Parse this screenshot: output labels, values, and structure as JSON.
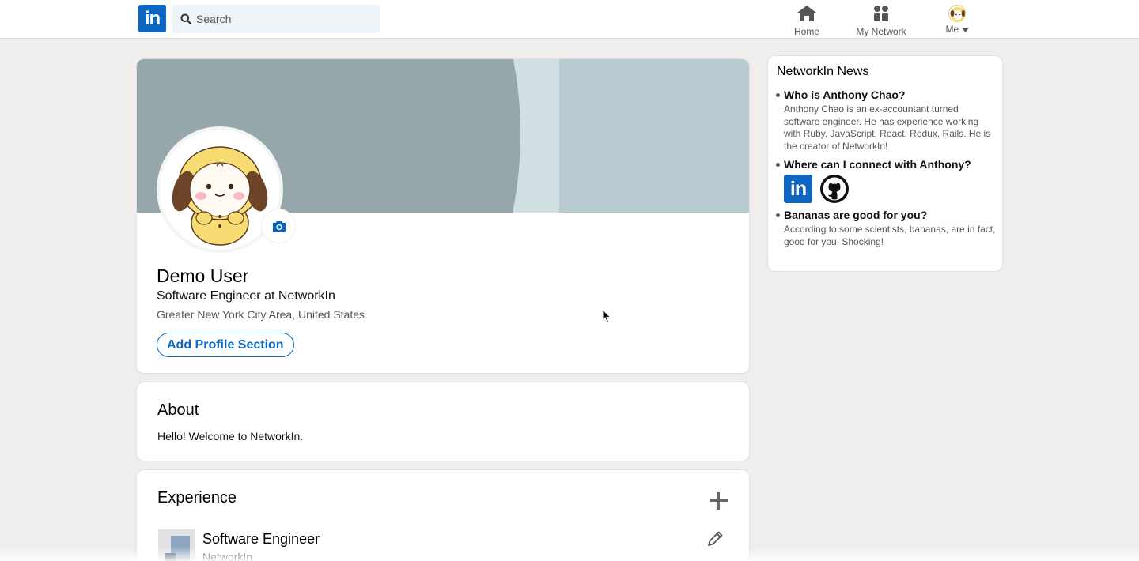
{
  "nav": {
    "logo_text": "in",
    "search_placeholder": "Search",
    "home_label": "Home",
    "network_label": "My Network",
    "me_label": "Me"
  },
  "profile": {
    "name": "Demo User",
    "headline": "Software Engineer at NetworkIn",
    "location": "Greater New York City Area, United States",
    "add_section_label": "Add Profile Section"
  },
  "about": {
    "title": "About",
    "text": "Hello! Welcome to NetworkIn."
  },
  "experience": {
    "title": "Experience",
    "items": [
      {
        "title": "Software Engineer",
        "company": "NetworkIn"
      }
    ]
  },
  "news": {
    "title": "NetworkIn News",
    "items": [
      {
        "question": "Who is Anthony Chao?",
        "answer": "Anthony Chao is an ex-accountant turned software engineer. He has experience working with Ruby, JavaScript, React, Redux, Rails. He is the creator of NetworkIn!"
      },
      {
        "question": "Where can I connect with Anthony?",
        "linkedin_text": "in"
      },
      {
        "question": "Bananas are good for you?",
        "answer": "According to some scientists, bananas, are in fact, good for you. Shocking!"
      }
    ]
  },
  "colors": {
    "brand": "#0a66c2",
    "background": "#efeeec",
    "banner_dark": "#95a7ab",
    "banner_light": "#d1dfe2",
    "banner_right": "#b8cbd1"
  },
  "icons": [
    "search-icon",
    "home-icon",
    "network-icon",
    "camera-icon",
    "plus-icon",
    "pencil-icon",
    "github-icon",
    "caret-down-icon"
  ]
}
